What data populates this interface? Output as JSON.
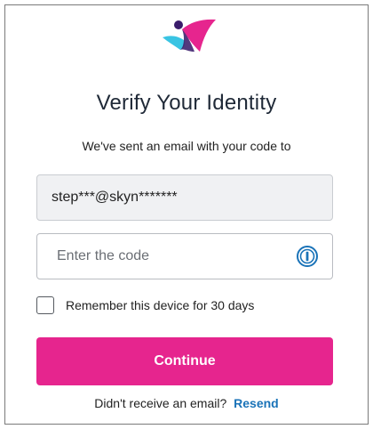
{
  "logo": {
    "icon": "brand-logo",
    "colors": {
      "pink": "#e6258e",
      "cyan": "#39c4e3",
      "purple": "#3a1c6b"
    }
  },
  "header": {
    "title": "Verify Your Identity",
    "subtitle": "We've sent an email with your code to"
  },
  "form": {
    "email_masked": "step***@skyn*******",
    "code_input": {
      "placeholder": "Enter the code",
      "value": "",
      "icon": "password-manager-icon"
    },
    "remember": {
      "label": "Remember this device for 30 days",
      "checked": false
    },
    "continue_label": "Continue"
  },
  "footer": {
    "prompt": "Didn't receive an email?",
    "resend_label": "Resend"
  },
  "colors": {
    "accent": "#e6258e",
    "link": "#1a73b8",
    "field_bg": "#f0f1f3"
  }
}
